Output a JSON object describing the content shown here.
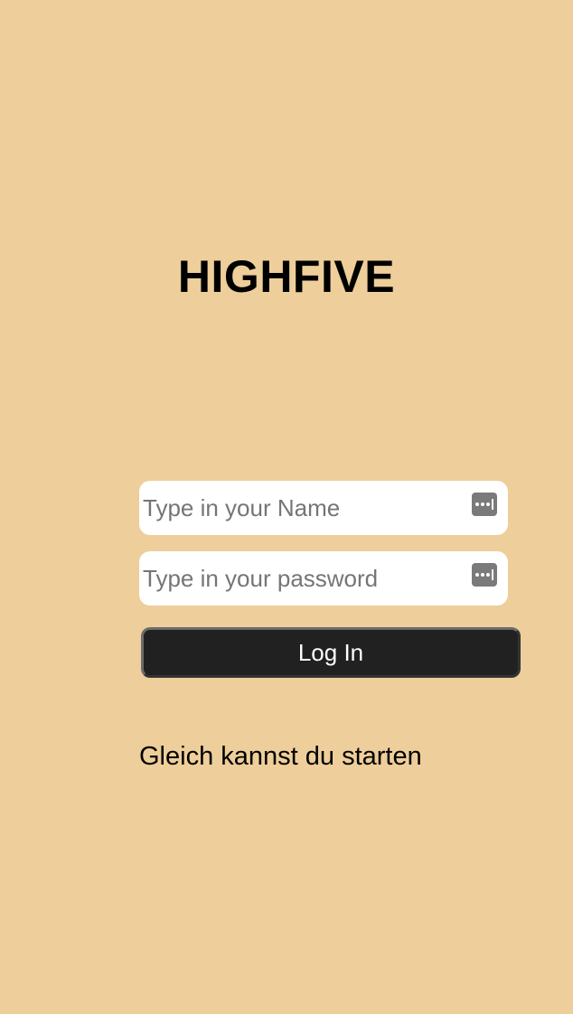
{
  "app": {
    "title": "HIGHFIVE"
  },
  "login": {
    "name_placeholder": "Type in your Name",
    "name_value": "",
    "password_placeholder": "Type in your password",
    "password_value": "",
    "submit_label": "Log In"
  },
  "status": {
    "message": "Gleich kannst du starten"
  },
  "icons": {
    "name_field_icon": "password-manager-key-icon",
    "password_field_icon": "password-manager-key-icon"
  },
  "colors": {
    "background": "#EECE9A",
    "button": "#212121",
    "button_text": "#FFFFFF",
    "field": "#FFFFFF"
  }
}
